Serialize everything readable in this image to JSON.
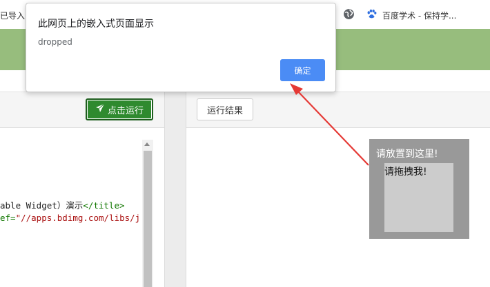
{
  "bookmarks": {
    "left_label": "已导入",
    "baidu_label": "百度学术 - 保持学..."
  },
  "toolbar": {
    "run_label": "点击运行",
    "result_label": "运行结果"
  },
  "code": {
    "line1": [
      {
        "cls": "c-text",
        "text": "able Widget）演示"
      },
      {
        "cls": "c-tag",
        "text": "</title>"
      }
    ],
    "line2": [
      {
        "cls": "c-tag",
        "text": "ef="
      },
      {
        "cls": "c-str",
        "text": "\"//apps.bdimg.com/libs/j"
      }
    ]
  },
  "result": {
    "drop_label": "请放置到这里!",
    "drag_label": "请拖拽我!"
  },
  "dialog": {
    "title": "此网页上的嵌入式页面显示",
    "message": "dropped",
    "ok_label": "确定"
  },
  "colors": {
    "banner": "#97bd7d",
    "run_button": "#2f8a2f",
    "dialog_ok": "#4b8cf5",
    "annotation_arrow": "#e53935"
  }
}
